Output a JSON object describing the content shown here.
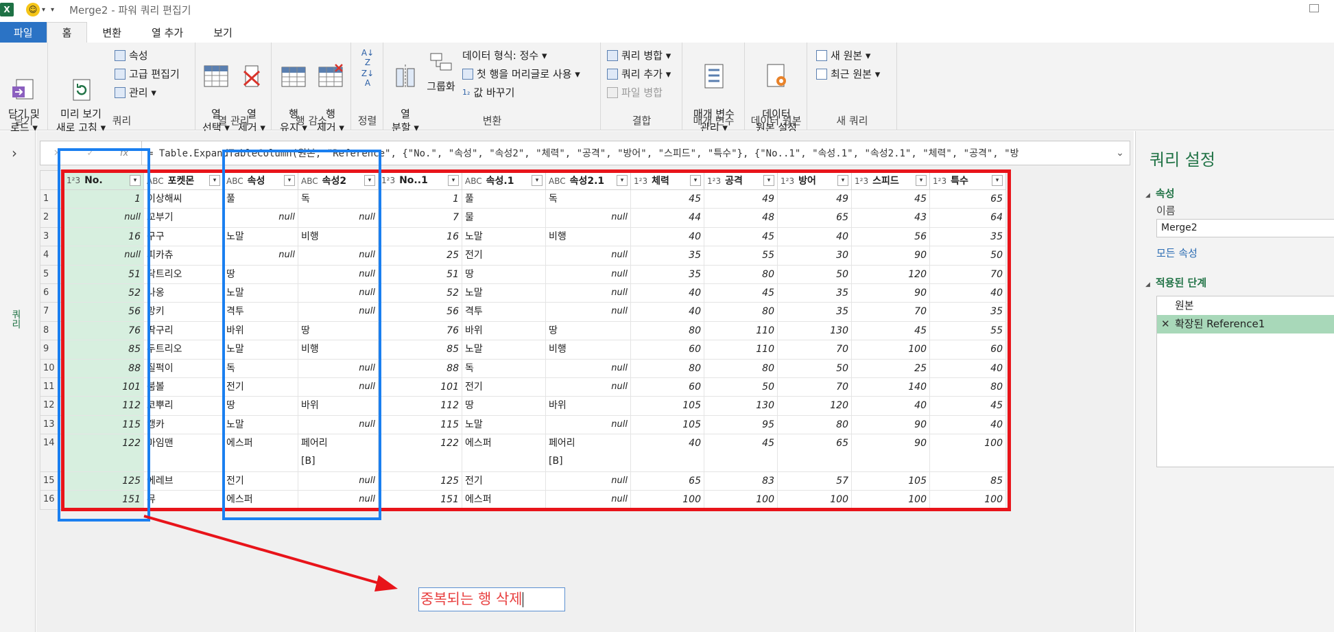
{
  "window": {
    "title": "Merge2 - 파워 쿼리 편집기",
    "excel_logo": "X"
  },
  "menu": {
    "tabs": [
      "파일",
      "홈",
      "변환",
      "열 추가",
      "보기"
    ],
    "active_tab": "홈"
  },
  "ribbon": {
    "close": {
      "button": "닫기 및\n로드 ▾",
      "group": "닫기"
    },
    "query": {
      "refresh": "미리 보기\n새로 고침 ▾",
      "properties": "속성",
      "advanced_editor": "고급 편집기",
      "manage": "관리 ▾",
      "group": "쿼리"
    },
    "columns": {
      "choose": "열\n선택 ▾",
      "remove": "열\n제거 ▾",
      "group": "열 관리"
    },
    "rows": {
      "keep": "행\n유지 ▾",
      "remove": "행\n제거 ▾",
      "group": "행 감소"
    },
    "sort": {
      "group": "정렬"
    },
    "transform": {
      "split": "열\n분할 ▾",
      "group_by": "그룹화",
      "data_type": "데이터 형식: 정수 ▾",
      "first_row_header": "첫 행을 머리글로 사용 ▾",
      "replace_values": "값 바꾸기",
      "group": "변환"
    },
    "combine": {
      "merge_queries": "쿼리 병합 ▾",
      "append_queries": "쿼리 추가 ▾",
      "combine_files": "파일 병합",
      "group": "결합"
    },
    "params": {
      "manage": "매개 변수\n관리 ▾",
      "group": "매개 변수"
    },
    "datasource": {
      "settings": "데이터\n원본 설정",
      "group": "데이터 원본"
    },
    "newquery": {
      "new_source": "새 원본 ▾",
      "recent_sources": "최근 원본 ▾",
      "group": "새 쿼리"
    }
  },
  "left_panel": {
    "label": "쿼리"
  },
  "formula_bar": {
    "text": "= Table.ExpandTableColumn(원본, \"Reference\", {\"No.\", \"속성\", \"속성2\", \"체력\", \"공격\", \"방어\", \"스피드\", \"특수\"}, {\"No..1\", \"속성.1\", \"속성2.1\", \"체력\", \"공격\", \"방"
  },
  "grid": {
    "columns": [
      {
        "type": "1²3",
        "name": "No."
      },
      {
        "type": "ABC",
        "name": "포켓몬"
      },
      {
        "type": "ABC",
        "name": "속성"
      },
      {
        "type": "ABC",
        "name": "속성2"
      },
      {
        "type": "1²3",
        "name": "No..1"
      },
      {
        "type": "ABC",
        "name": "속성.1"
      },
      {
        "type": "ABC",
        "name": "속성2.1"
      },
      {
        "type": "1²3",
        "name": "체력"
      },
      {
        "type": "1²3",
        "name": "공격"
      },
      {
        "type": "1²3",
        "name": "방어"
      },
      {
        "type": "1²3",
        "name": "스피드"
      },
      {
        "type": "1²3",
        "name": "특수"
      }
    ],
    "rows": [
      [
        "1",
        "1",
        "이상해씨",
        "풀",
        "독",
        "1",
        "풀",
        "독",
        "45",
        "49",
        "49",
        "45",
        "65"
      ],
      [
        "2",
        "null",
        "꼬부기",
        "null",
        "null",
        "7",
        "물",
        "null",
        "44",
        "48",
        "65",
        "43",
        "64"
      ],
      [
        "3",
        "16",
        "구구",
        "노말",
        "비행",
        "16",
        "노말",
        "비행",
        "40",
        "45",
        "40",
        "56",
        "35"
      ],
      [
        "4",
        "null",
        "피카츄",
        "null",
        "null",
        "25",
        "전기",
        "null",
        "35",
        "55",
        "30",
        "90",
        "50"
      ],
      [
        "5",
        "51",
        "닥트리오",
        "땅",
        "null",
        "51",
        "땅",
        "null",
        "35",
        "80",
        "50",
        "120",
        "70"
      ],
      [
        "6",
        "52",
        "나옹",
        "노말",
        "null",
        "52",
        "노말",
        "null",
        "40",
        "45",
        "35",
        "90",
        "40"
      ],
      [
        "7",
        "56",
        "망키",
        "격투",
        "null",
        "56",
        "격투",
        "null",
        "40",
        "80",
        "35",
        "70",
        "35"
      ],
      [
        "8",
        "76",
        "딱구리",
        "바위",
        "땅",
        "76",
        "바위",
        "땅",
        "80",
        "110",
        "130",
        "45",
        "55"
      ],
      [
        "9",
        "85",
        "두트리오",
        "노말",
        "비행",
        "85",
        "노말",
        "비행",
        "60",
        "110",
        "70",
        "100",
        "60"
      ],
      [
        "10",
        "88",
        "질퍽이",
        "독",
        "null",
        "88",
        "독",
        "null",
        "80",
        "80",
        "50",
        "25",
        "40"
      ],
      [
        "11",
        "101",
        "붐볼",
        "전기",
        "null",
        "101",
        "전기",
        "null",
        "60",
        "50",
        "70",
        "140",
        "80"
      ],
      [
        "12",
        "112",
        "코뿌리",
        "땅",
        "바위",
        "112",
        "땅",
        "바위",
        "105",
        "130",
        "120",
        "40",
        "45"
      ],
      [
        "13",
        "115",
        "캥카",
        "노말",
        "null",
        "115",
        "노말",
        "null",
        "105",
        "95",
        "80",
        "90",
        "40"
      ],
      [
        "14",
        "122",
        "마임맨",
        "에스퍼",
        "페어리\n[B]",
        "122",
        "에스퍼",
        "페어리\n[B]",
        "40",
        "45",
        "65",
        "90",
        "100"
      ],
      [
        "15",
        "125",
        "에레브",
        "전기",
        "null",
        "125",
        "전기",
        "null",
        "65",
        "83",
        "57",
        "105",
        "85"
      ],
      [
        "16",
        "151",
        "뮤",
        "에스퍼",
        "null",
        "151",
        "에스퍼",
        "null",
        "100",
        "100",
        "100",
        "100",
        "100"
      ]
    ]
  },
  "annotation": {
    "text": "중복되는 행 삭제"
  },
  "query_settings": {
    "title": "쿼리 설정",
    "properties_section": "속성",
    "name_label": "이름",
    "name_value": "Merge2",
    "all_properties": "모든 속성",
    "steps_section": "적용된 단계",
    "steps": [
      "원본",
      "확장된 Reference1"
    ],
    "selected_step": "확장된 Reference1"
  },
  "colors": {
    "excel_green": "#217346",
    "file_tab": "#2b73c5",
    "annotation_red": "#e8141a",
    "annotation_blue": "#1a7ff0",
    "selected_column": "#d7efdf"
  }
}
